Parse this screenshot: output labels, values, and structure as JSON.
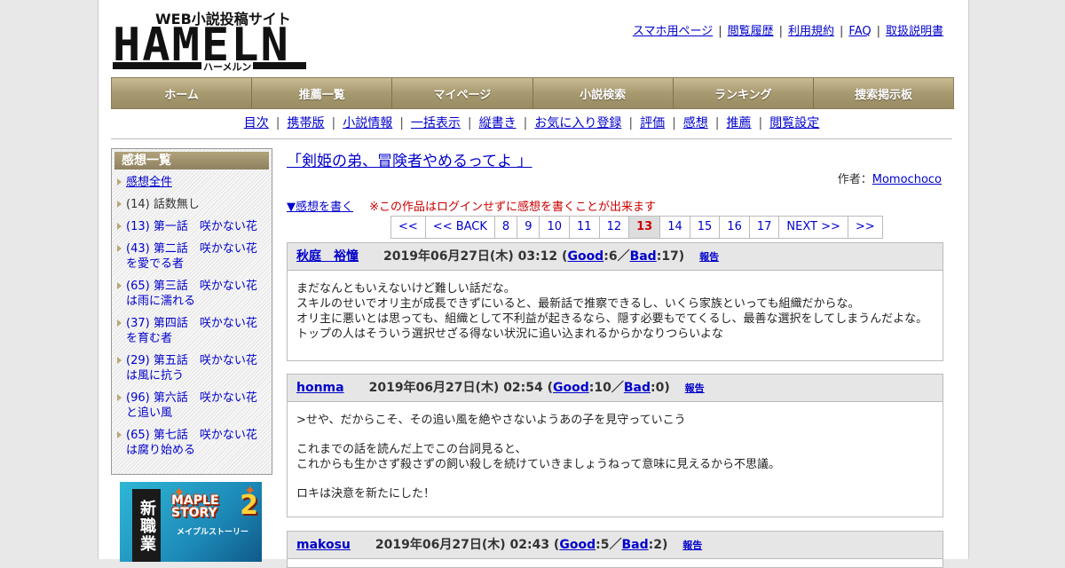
{
  "logo": {
    "top_text": "WEB小説投稿サイト",
    "main_text": "HAMELN",
    "sub_text": "ハーメルン"
  },
  "toplinks": [
    "スマホ用ページ",
    "閲覧履歴",
    "利用規約",
    "FAQ",
    "取扱説明書"
  ],
  "gnav": [
    "ホーム",
    "推薦一覧",
    "マイページ",
    "小説検索",
    "ランキング",
    "捜索掲示板"
  ],
  "subnav": [
    "目次",
    "携帯版",
    "小説情報",
    "一括表示",
    "縦書き",
    "お気に入り登録",
    "評価",
    "感想",
    "推薦",
    "閲覧設定"
  ],
  "sidebar": {
    "title": "感想一覧",
    "items": [
      {
        "count": "",
        "label": "感想全件",
        "linked": true
      },
      {
        "count": "(14)",
        "label": "話数無し",
        "linked": false
      },
      {
        "count": "(13)",
        "label": "第一話　咲かない花",
        "linked": true
      },
      {
        "count": "(43)",
        "label": "第二話　咲かない花を愛でる者",
        "linked": true
      },
      {
        "count": "(65)",
        "label": "第三話　咲かない花は雨に濡れる",
        "linked": true
      },
      {
        "count": "(37)",
        "label": "第四話　咲かない花を育む者",
        "linked": true
      },
      {
        "count": "(29)",
        "label": "第五話　咲かない花は風に抗う",
        "linked": true
      },
      {
        "count": "(96)",
        "label": "第六話　咲かない花と追い風",
        "linked": true
      },
      {
        "count": "(65)",
        "label": "第七話　咲かない花は腐り始める",
        "linked": true
      }
    ]
  },
  "ad": {
    "job_text": "新職業",
    "brand": "MAPLE STORY",
    "brand_number": "2",
    "brand_sub": "メイプルストーリー"
  },
  "main": {
    "title": "「剣姫の弟、冒険者やめるってよ 」",
    "author_label": "作者：",
    "author_name": "Momochoco",
    "write_link": "▼感想を書く",
    "warning": "※この作品はログインせずに感想を書くことが出来ます"
  },
  "pager": [
    "<<",
    "<< BACK",
    "8",
    "9",
    "10",
    "11",
    "12",
    "13",
    "14",
    "15",
    "16",
    "17",
    "NEXT >>",
    ">>"
  ],
  "pager_current": "13",
  "comments": [
    {
      "user": "秋庭　裕憧",
      "date": "2019年06月27日(木) 03:12",
      "good": "6",
      "bad": "17",
      "report": "報告",
      "lines": [
        "まだなんともいえないけど難しい話だな。",
        "スキルのせいでオリ主が成長できずにいると、最新話で推察できるし、いくら家族といっても組織だからな。",
        "オリ主に悪いとは思っても、組織として不利益が起きるなら、隠す必要もでてくるし、最善な選択をしてしまうんだよな。",
        "トップの人はそういう選択せざる得ない状況に追い込まれるからかなりつらいよな"
      ]
    },
    {
      "user": "honma",
      "date": "2019年06月27日(木) 02:54",
      "good": "10",
      "bad": "0",
      "report": "報告",
      "lines": [
        ">せや、だからこそ、その追い風を絶やさないようあの子を見守っていこう",
        "これまでの話を読んだ上でこの台詞見ると、",
        "これからも生かさず殺さずの飼い殺しを続けていきましょうねって意味に見えるから不思議。",
        "ロキは決意を新たにした！"
      ]
    },
    {
      "user": "makosu",
      "date": "2019年06月27日(木) 02:43",
      "good": "5",
      "bad": "2",
      "report": "報告",
      "lines": []
    }
  ],
  "labels": {
    "good": "Good",
    "bad": "Bad",
    "slash": "／"
  }
}
